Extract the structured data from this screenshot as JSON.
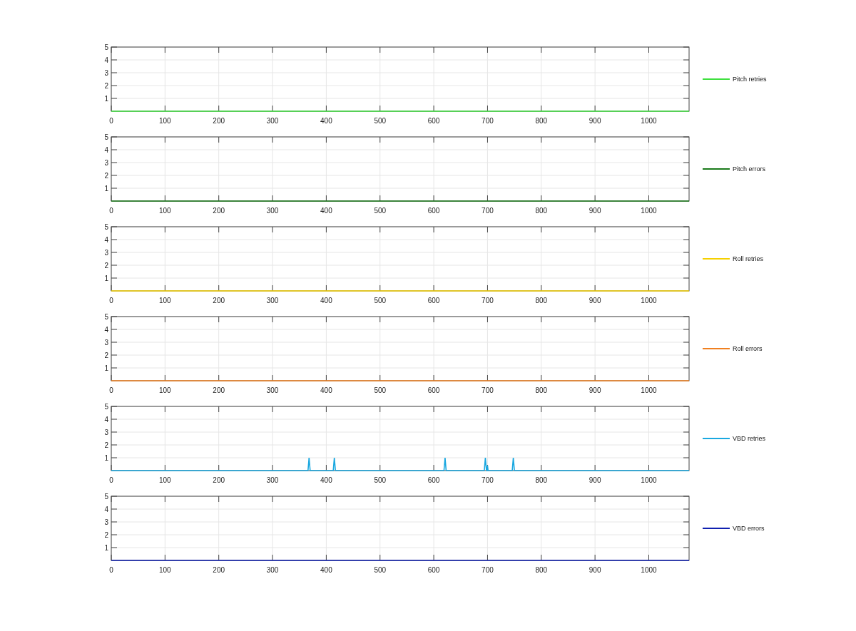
{
  "charts": [
    {
      "chart_data": {
        "type": "line",
        "grid": true,
        "x": [
          0,
          1075
        ],
        "xlim": [
          0,
          1075
        ],
        "ylim": [
          0,
          5
        ],
        "xticks": [
          0,
          100,
          200,
          300,
          400,
          500,
          600,
          700,
          800,
          900,
          1000
        ],
        "yticks": [
          1,
          2,
          3,
          4,
          5
        ],
        "series": [
          {
            "name": "Pitch retries",
            "color": "#3fe03f",
            "values": [
              0,
              0
            ]
          }
        ]
      }
    },
    {
      "chart_data": {
        "type": "line",
        "grid": true,
        "x": [
          0,
          1075
        ],
        "xlim": [
          0,
          1075
        ],
        "ylim": [
          0,
          5
        ],
        "xticks": [
          0,
          100,
          200,
          300,
          400,
          500,
          600,
          700,
          800,
          900,
          1000
        ],
        "yticks": [
          1,
          2,
          3,
          4,
          5
        ],
        "series": [
          {
            "name": "Pitch errors",
            "color": "#1a7a1a",
            "values": [
              0,
              0
            ]
          }
        ]
      }
    },
    {
      "chart_data": {
        "type": "line",
        "grid": true,
        "x": [
          0,
          1075
        ],
        "xlim": [
          0,
          1075
        ],
        "ylim": [
          0,
          5
        ],
        "xticks": [
          0,
          100,
          200,
          300,
          400,
          500,
          600,
          700,
          800,
          900,
          1000
        ],
        "yticks": [
          1,
          2,
          3,
          4,
          5
        ],
        "series": [
          {
            "name": "Roll retries",
            "color": "#f5d000",
            "values": [
              0,
              0
            ]
          }
        ]
      }
    },
    {
      "chart_data": {
        "type": "line",
        "grid": true,
        "x": [
          0,
          1075
        ],
        "xlim": [
          0,
          1075
        ],
        "ylim": [
          0,
          5
        ],
        "xticks": [
          0,
          100,
          200,
          300,
          400,
          500,
          600,
          700,
          800,
          900,
          1000
        ],
        "yticks": [
          1,
          2,
          3,
          4,
          5
        ],
        "series": [
          {
            "name": "Roll errors",
            "color": "#f08020",
            "values": [
              0,
              0
            ]
          }
        ]
      }
    },
    {
      "chart_data": {
        "type": "line",
        "grid": true,
        "x": [
          0,
          366,
          368,
          370,
          413,
          415,
          417,
          619,
          621,
          623,
          694,
          696,
          698,
          699,
          700,
          701,
          746,
          748,
          750,
          1075
        ],
        "xlim": [
          0,
          1075
        ],
        "ylim": [
          0,
          5
        ],
        "xticks": [
          0,
          100,
          200,
          300,
          400,
          500,
          600,
          700,
          800,
          900,
          1000
        ],
        "yticks": [
          1,
          2,
          3,
          4,
          5
        ],
        "series": [
          {
            "name": "VBD retries",
            "color": "#1aa8e0",
            "values": [
              0,
              0,
              1,
              0,
              0,
              1,
              0,
              0,
              1,
              0,
              0,
              1,
              0,
              0,
              0.4,
              0,
              0,
              1,
              0,
              0
            ]
          }
        ]
      }
    },
    {
      "chart_data": {
        "type": "line",
        "grid": true,
        "x": [
          0,
          1075
        ],
        "xlim": [
          0,
          1075
        ],
        "ylim": [
          0,
          5
        ],
        "xticks": [
          0,
          100,
          200,
          300,
          400,
          500,
          600,
          700,
          800,
          900,
          1000
        ],
        "yticks": [
          1,
          2,
          3,
          4,
          5
        ],
        "series": [
          {
            "name": "VBD errors",
            "color": "#1020b0",
            "values": [
              0,
              0
            ]
          }
        ]
      }
    }
  ]
}
